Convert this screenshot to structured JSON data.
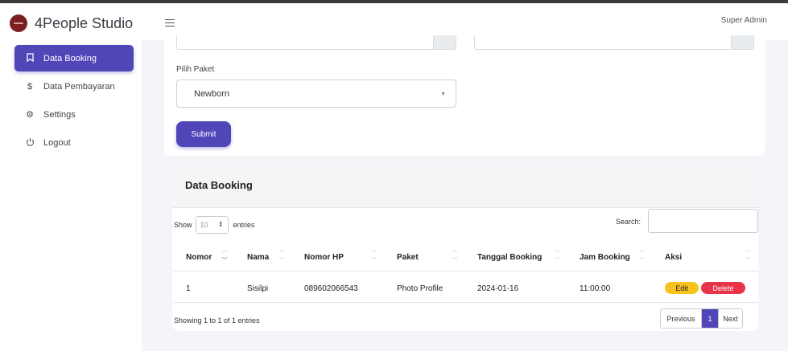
{
  "app": {
    "title": "4People Studio"
  },
  "topbar": {
    "user": "Super Admin"
  },
  "sidebar": {
    "items": [
      {
        "icon": "bookmark-icon",
        "label": "Data Booking",
        "active": true
      },
      {
        "icon": "dollar-icon",
        "label": "Data Pembayaran",
        "active": false
      },
      {
        "icon": "gear-icon",
        "label": "Settings",
        "active": false
      },
      {
        "icon": "power-icon",
        "label": "Logout",
        "active": false
      }
    ]
  },
  "form": {
    "paket_label": "Pilih Paket",
    "paket_value": "Newborn",
    "submit_label": "Submit"
  },
  "table_card": {
    "title": "Data Booking",
    "show_label": "Show",
    "entries_value": "10",
    "entries_label": "entries",
    "search_label": "Search:",
    "columns": [
      "Nomor",
      "Nama",
      "Nomor HP",
      "Paket",
      "Tanggal Booking",
      "Jam Booking",
      "Aksi"
    ],
    "rows": [
      [
        "1",
        "Sisilpi",
        "089602066543",
        "Photo Profile",
        "2024-01-16",
        "11:00:00"
      ]
    ],
    "edit_label": "Edit",
    "delete_label": "Delete",
    "info": "Showing 1 to 1 of 1 entries",
    "pagination": {
      "prev": "Previous",
      "page": "1",
      "next": "Next"
    }
  },
  "colors": {
    "accent": "#5046b8",
    "edit": "#f7c21b",
    "delete": "#e8344a"
  }
}
